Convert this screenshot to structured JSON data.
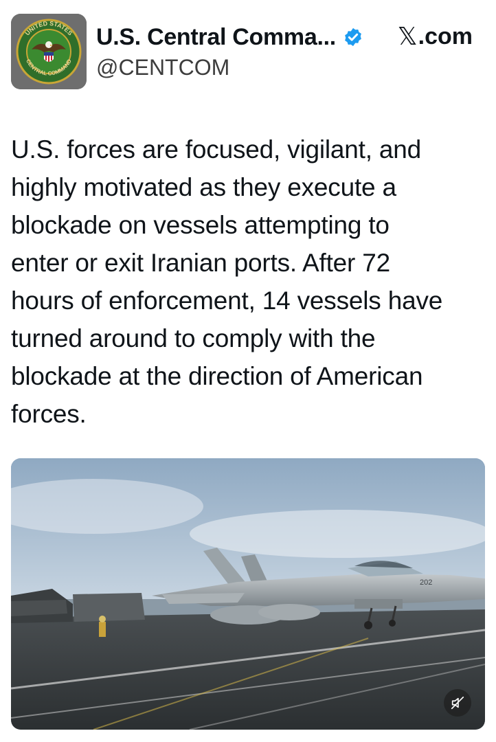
{
  "account": {
    "display_name": "U.S. Central Comma...",
    "handle": "@CENTCOM",
    "verified": true,
    "avatar_icon": "centcom-seal-icon",
    "avatar_text_top": "UNITED STATES",
    "avatar_text_bottom": "CENTRAL COMMAND"
  },
  "site": {
    "label": ".com",
    "logo_icon": "x-logo-icon",
    "logo_glyph": "𝕏"
  },
  "tweet": {
    "lines": [
      "U.S. forces are focused, vigilant, and",
      "highly motivated as they execute a",
      "blockade on vessels attempting to",
      "enter or exit Iranian ports. After 72",
      "hours of enforcement, 14 vessels have",
      "turned around to comply with the",
      "blockade at the direction of American",
      "forces."
    ]
  },
  "media": {
    "type": "video",
    "aircraft_number": "202",
    "mute_icon": "speaker-muted-icon"
  },
  "colors": {
    "verified": "#1d9bf0",
    "text": "#0f1419",
    "handle": "#3d3d3d"
  }
}
